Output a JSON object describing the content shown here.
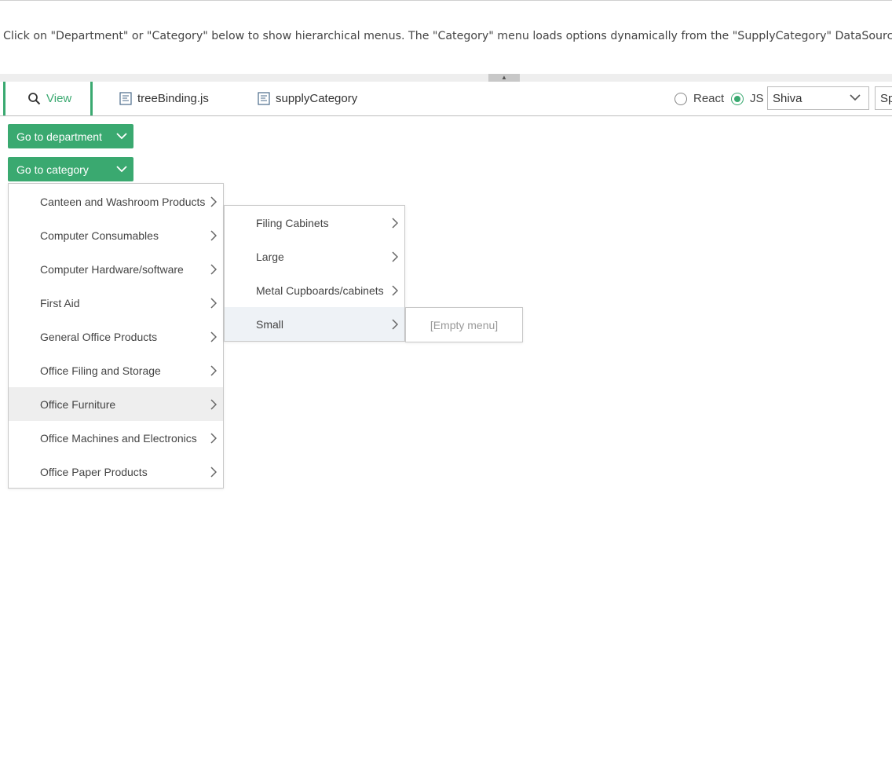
{
  "description": "Click on \"Department\" or \"Category\" below to show hierarchical menus. The \"Category\" menu loads options dynamically from the \"SupplyCategory\" DataSource.",
  "tabs": [
    {
      "label": "View",
      "icon": "search-icon",
      "active": true
    },
    {
      "label": "treeBinding.js",
      "icon": "file-icon",
      "active": false
    },
    {
      "label": "supplyCategory",
      "icon": "file-icon",
      "active": false
    }
  ],
  "framework": {
    "react_label": "React",
    "js_label": "JS",
    "selected": "JS"
  },
  "skin_select": {
    "value": "Shiva"
  },
  "size_select": {
    "value": "Sp"
  },
  "buttons": {
    "department": "Go to department",
    "category": "Go to category"
  },
  "category_menu": {
    "items": [
      "Canteen and Washroom Products",
      "Computer Consumables",
      "Computer Hardware/software",
      "First Aid",
      "General Office Products",
      "Office Filing and Storage",
      "Office Furniture",
      "Office Machines and Electronics",
      "Office Paper Products"
    ],
    "highlighted": "Office Furniture"
  },
  "furniture_submenu": {
    "items": [
      "Filing Cabinets",
      "Large",
      "Metal Cupboards/cabinets",
      "Small"
    ],
    "highlighted": "Small"
  },
  "small_submenu": {
    "empty_text": "[Empty menu]"
  },
  "colors": {
    "accent": "#3aa970",
    "highlight_main": "#eeeeee",
    "highlight_sub": "#eef2f6"
  }
}
